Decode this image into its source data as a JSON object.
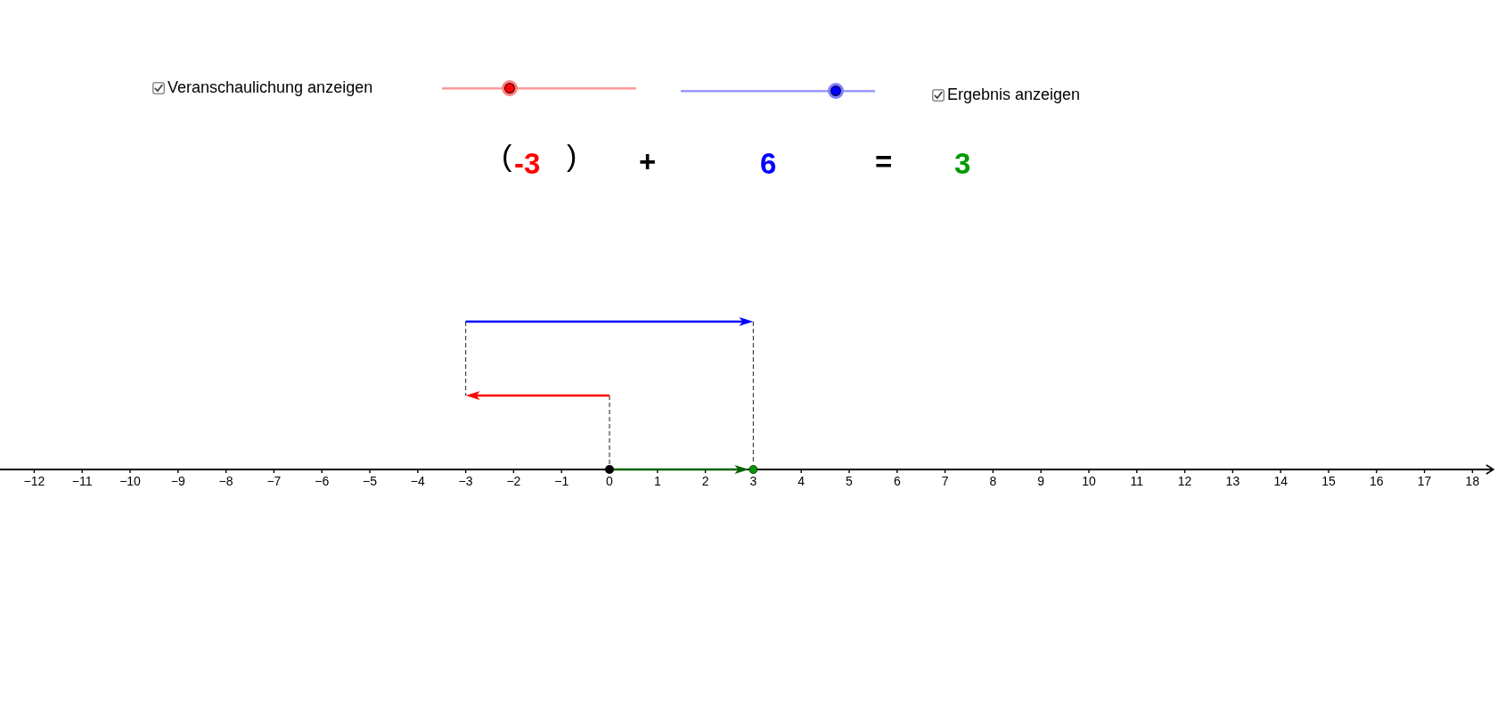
{
  "controls": [
    {
      "kind": "checkbox",
      "label": "Veranschaulichung anzeigen",
      "checked": true
    },
    {
      "kind": "slider",
      "level": 0.35,
      "color": "#ff0000"
    },
    {
      "kind": "slider",
      "level": 0.8,
      "color": "#0000ff"
    },
    {
      "kind": "checkbox",
      "label": "Ergebnis anzeigen",
      "checked": true
    }
  ],
  "equation": [
    {
      "kind": "paren",
      "text": "("
    },
    {
      "kind": "summand",
      "text": "-3",
      "color": "#ff0000"
    },
    {
      "kind": "paren",
      "text": ")"
    },
    {
      "kind": "operator",
      "text": "+"
    },
    {
      "kind": "summand",
      "text": "6",
      "color": "#0000ff"
    },
    {
      "kind": "operator",
      "text": "="
    },
    {
      "kind": "result",
      "text": "3",
      "color": "#009900"
    }
  ],
  "number_line": {
    "labels": [
      "−12",
      "−11",
      "−10",
      "−9",
      "−8",
      "−7",
      "−6",
      "−5",
      "−4",
      "−3",
      "−2",
      "−1",
      "0",
      "1",
      "2",
      "3",
      "4",
      "5",
      "6",
      "7",
      "8",
      "9",
      "10",
      "11",
      "12",
      "13",
      "14",
      "15",
      "16",
      "17",
      "18"
    ]
  }
}
